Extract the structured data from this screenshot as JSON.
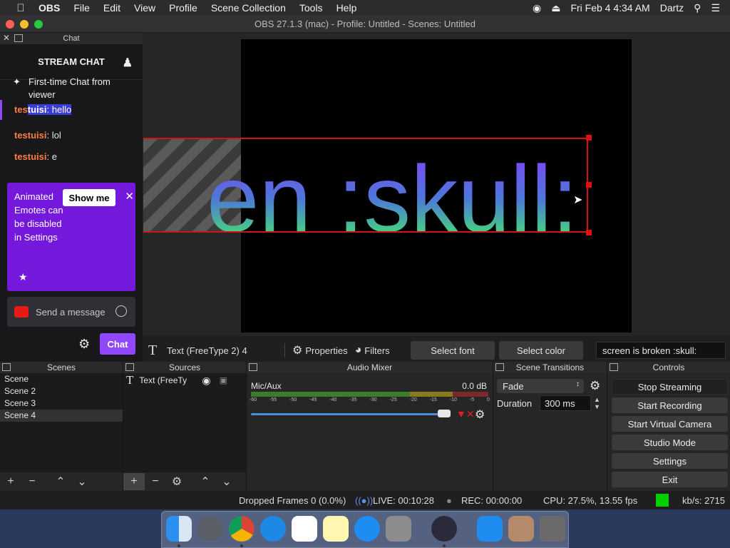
{
  "menubar": {
    "app_name": "OBS",
    "items": [
      "File",
      "Edit",
      "View",
      "Profile",
      "Scene Collection",
      "Tools",
      "Help"
    ],
    "datetime": "Fri Feb 4  4:34 AM",
    "user": "Dartz"
  },
  "window": {
    "title": "OBS 27.1.3 (mac) - Profile: Untitled - Scenes: Untitled"
  },
  "chat": {
    "dock_title": "Chat",
    "header": "STREAM CHAT",
    "first_msg": "First-time Chat from viewer",
    "messages": [
      {
        "user": "tes",
        "user_sel": "tuisi",
        "text": ": hello"
      },
      {
        "user": "testuisi",
        "text": ": lol"
      },
      {
        "user": "testuisi",
        "text": ": e"
      }
    ],
    "promo": {
      "text": "Animated Emotes can be disabled in Settings",
      "button": "Show me"
    },
    "input_placeholder": "Send a message",
    "send_button": "Chat"
  },
  "preview": {
    "text": "en :skull:"
  },
  "context": {
    "source_name": "Text (FreeType 2) 4",
    "properties": "Properties",
    "filters": "Filters",
    "select_font": "Select font",
    "select_color": "Select color",
    "text_value": "screen is broken :skull:"
  },
  "scenes": {
    "title": "Scenes",
    "items": [
      "Scene",
      "Scene 2",
      "Scene 3",
      "Scene 4"
    ],
    "selected": 3
  },
  "sources": {
    "title": "Sources",
    "items": [
      {
        "name": "Text (FreeTy"
      }
    ]
  },
  "mixer": {
    "title": "Audio Mixer",
    "track": "Mic/Aux",
    "level": "0.0 dB",
    "ticks": [
      "-60",
      "-55",
      "-50",
      "-45",
      "-40",
      "-35",
      "-30",
      "-25",
      "-20",
      "-15",
      "-10",
      "-5",
      "0"
    ],
    "volume_fraction": 0.96
  },
  "transitions": {
    "title": "Scene Transitions",
    "type": "Fade",
    "duration_label": "Duration",
    "duration": "300 ms"
  },
  "controls": {
    "title": "Controls",
    "buttons": [
      "Stop Streaming",
      "Start Recording",
      "Start Virtual Camera",
      "Studio Mode",
      "Settings",
      "Exit"
    ]
  },
  "status": {
    "dropped": "Dropped Frames 0 (0.0%)",
    "live": "LIVE: 00:10:28",
    "rec": "REC: 00:00:00",
    "cpu": "CPU: 27.5%, 13.55 fps",
    "kbs": "kb/s: 2715",
    "indicator_color": "#00d000"
  },
  "colors": {
    "accent": "#9147ff",
    "username": "#ff7f3f",
    "bbox": "#d01515"
  }
}
